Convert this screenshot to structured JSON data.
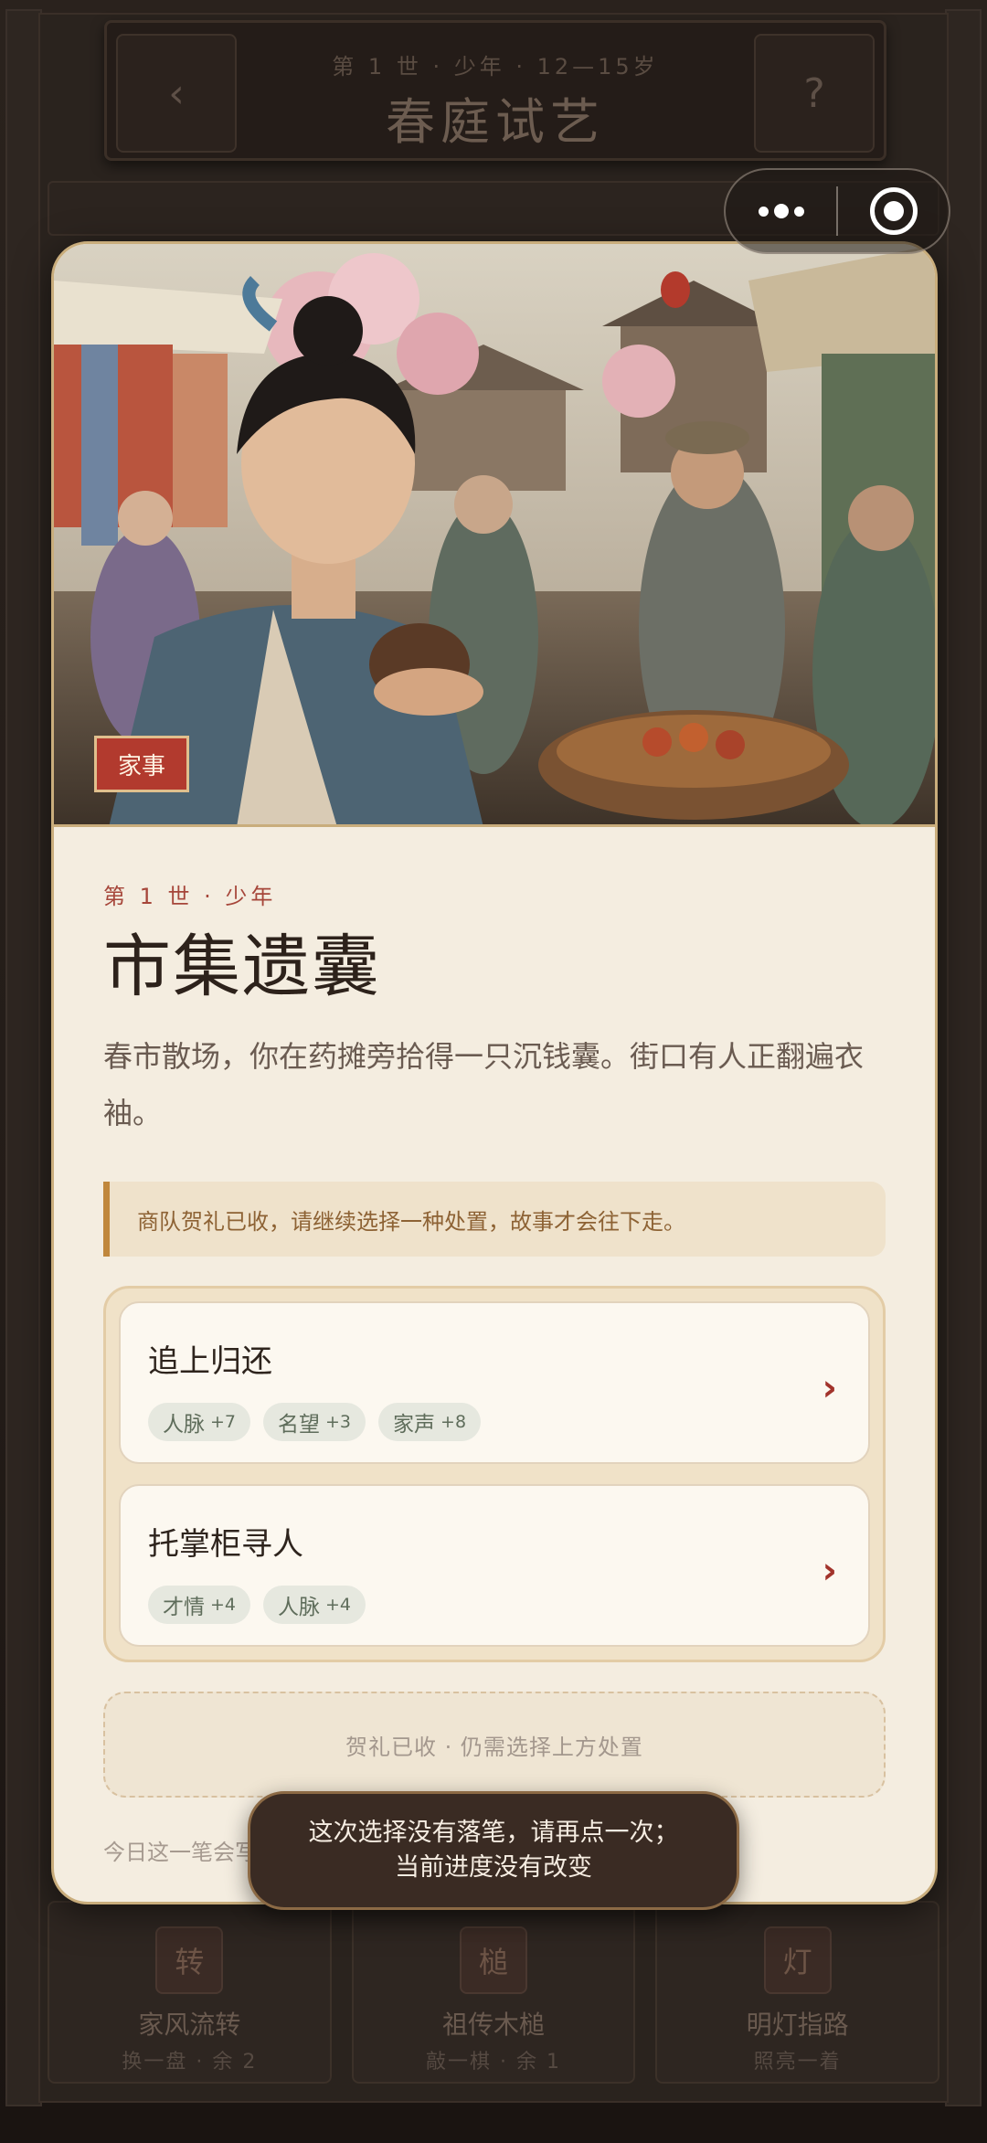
{
  "background": {
    "header": {
      "back_icon": "‹",
      "subtitle": "第 1 世 · 少年 · 12—15岁",
      "title": "春庭试艺",
      "help_icon": "?"
    },
    "items": [
      {
        "icon_char": "转",
        "name": "家风流转",
        "desc": "换一盘 · 余 2"
      },
      {
        "icon_char": "槌",
        "name": "祖传木槌",
        "desc": "敲一棋 · 余 1"
      },
      {
        "icon_char": "灯",
        "name": "明灯指路",
        "desc": "照亮一着"
      }
    ]
  },
  "event": {
    "tag": "家事",
    "meta": "第 1 世 · 少年",
    "title": "市集遗囊",
    "description": "春市散场，你在药摊旁拾得一只沉钱囊。街口有人正翻遍衣袖。",
    "notice": "商队贺礼已收，请继续选择一种处置，故事才会往下走。",
    "choices": [
      {
        "label": "追上归还",
        "effects": [
          {
            "stat": "人脉",
            "value": "+7"
          },
          {
            "stat": "名望",
            "value": "+3"
          },
          {
            "stat": "家声",
            "value": "+8"
          }
        ]
      },
      {
        "label": "托掌柜寻人",
        "effects": [
          {
            "stat": "才情",
            "value": "+4"
          },
          {
            "stat": "人脉",
            "value": "+4"
          }
        ]
      }
    ],
    "collected_hint": "贺礼已收 · 仍需选择上方处置",
    "footnote": "今日这一笔会写进"
  },
  "toast": {
    "line1": "这次选择没有落笔，请再点一次；",
    "line2": "当前进度没有改变"
  },
  "colors": {
    "accent_red": "#b23a2e",
    "card_bg": "#f4ede0",
    "gold_border": "#c9ad7c"
  }
}
